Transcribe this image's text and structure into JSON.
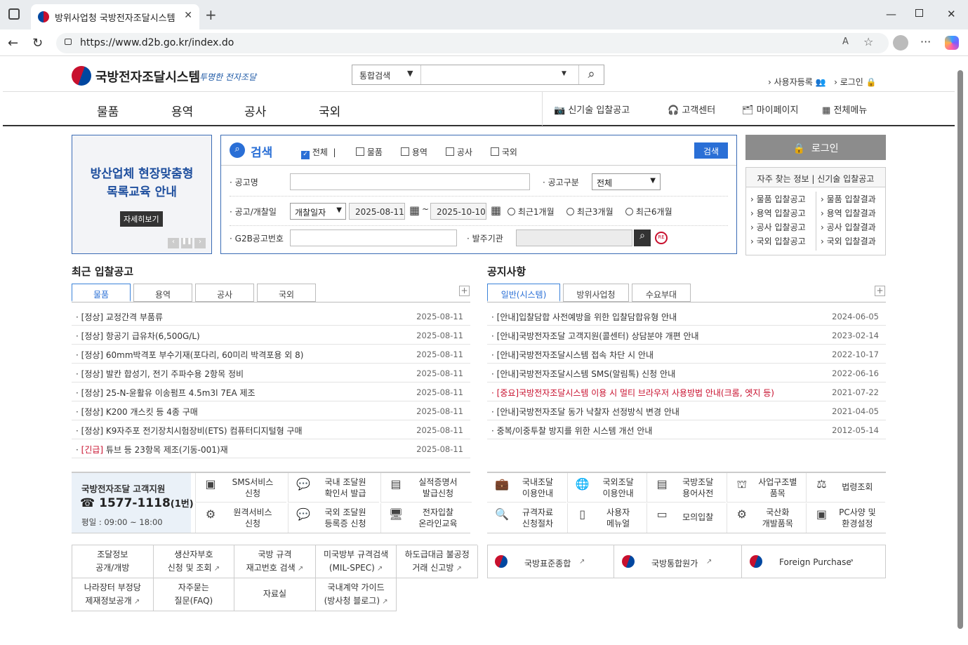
{
  "browser": {
    "tab_title": "방위사업청 국방전자조달시스템",
    "url": "https://www.d2b.go.kr/index.do"
  },
  "header": {
    "logo_text": "국방전자조달시스템",
    "slogan": "투명한 전자조달",
    "search_scope": "통합검색",
    "links": [
      "사용자등록",
      "로그인"
    ]
  },
  "nav": {
    "items": [
      "물품",
      "용역",
      "공사",
      "국외"
    ],
    "right": [
      "신기술 입찰공고",
      "고객센터",
      "마이페이지",
      "전체메뉴"
    ]
  },
  "banner": {
    "line1": "방산업체 현장맞춤형",
    "line2": "목록교육 안내",
    "button": "자세히보기"
  },
  "search": {
    "title": "검색",
    "checks": [
      "전체",
      "물품",
      "용역",
      "공사",
      "국외"
    ],
    "button": "검색",
    "label_name": "공고명",
    "label_type": "공고구분",
    "type_value": "전체",
    "label_date": "공고/개찰일",
    "date_type": "개찰일자",
    "date_from": "2025-08-11",
    "date_to": "2025-10-10",
    "date_sep": "~",
    "radios": [
      "최근1개월",
      "최근3개월",
      "최근6개월"
    ],
    "label_g2b": "G2B공고번호",
    "label_org": "발주기관"
  },
  "login": {
    "button": "로그인",
    "faq_title": "자주 찾는 정보 | 신기술 입찰공고",
    "links_left": [
      "물품 입찰공고",
      "용역 입찰공고",
      "공사 입찰공고",
      "국외 입찰공고"
    ],
    "links_right": [
      "물품 입찰결과",
      "용역 입찰결과",
      "공사 입찰결과",
      "국외 입찰결과"
    ]
  },
  "bids": {
    "title": "최근 입찰공고",
    "tabs": [
      "물품",
      "용역",
      "공사",
      "국외"
    ],
    "rows": [
      {
        "text": "[정상] 교정간격 부품류",
        "date": "2025-08-11"
      },
      {
        "text": "[정상] 항공기 급유차(6,500G/L)",
        "date": "2025-08-11"
      },
      {
        "text": "[정상] 60mm박격포 부수기재(포다리, 60미리 박격포용 외 8)",
        "date": "2025-08-11"
      },
      {
        "text": "[정상] 발칸 합성기, 전기 주파수용 2항목 정비",
        "date": "2025-08-11"
      },
      {
        "text": "[정상] 25-N-윤활유 이송펌프 4.5m3l 7EA 제조",
        "date": "2025-08-11"
      },
      {
        "text": "[정상] K200 개스킷 등 4종 구매",
        "date": "2025-08-11"
      },
      {
        "text": "[정상] K9자주포 전기장치시험장비(ETS) 컴퓨터디지털형 구매",
        "date": "2025-08-11"
      },
      {
        "text": "[긴급] 튜브 등 23항목 제조(기동-001)재",
        "date": "2025-08-11",
        "urgent_tag": "[긴급]",
        "rest": " 튜브 등 23항목 제조(기동-001)재"
      }
    ]
  },
  "notices": {
    "title": "공지사항",
    "tabs": [
      "일반(시스템)",
      "방위사업청",
      "수요부대"
    ],
    "rows": [
      {
        "text": "[안내]입찰담합 사전예방을 위한 입찰담합유형 안내",
        "date": "2024-06-05"
      },
      {
        "text": "[안내]국방전자조달 고객지원(콜센터) 상담분야 개편 안내",
        "date": "2023-02-14"
      },
      {
        "text": "[안내]국방전자조달시스템 접속 차단 시 안내",
        "date": "2022-10-17"
      },
      {
        "text": "[안내]국방전자조달시스템 SMS(알림톡) 신청 안내",
        "date": "2022-06-16"
      },
      {
        "text": "[중요]국방전자조달시스템 이용 시 멀티 브라우저 사용방법 안내(크롬, 엣지 등)",
        "date": "2021-07-22",
        "important": true
      },
      {
        "text": "[안내]국방전자조달 동가 낙찰자 선정방식 변경 안내",
        "date": "2021-04-05"
      },
      {
        "text": "중복/이중투찰 방지를 위한 시스템 개선 안내",
        "date": "2012-05-14"
      }
    ]
  },
  "support": {
    "title": "국방전자조달 고객지원",
    "phone": "1577-1118",
    "phone_ext": "(1번)",
    "hours": "평일 : 09:00 ~ 18:00",
    "services": [
      [
        "SMS서비스",
        "신청"
      ],
      [
        "국내 조달원",
        "확인서 발급"
      ],
      [
        "실적증명서",
        "발급신청"
      ],
      [
        "원격서비스",
        "신청"
      ],
      [
        "국외 조달원",
        "등록증 신청"
      ],
      [
        "전자입찰",
        "온라인교육"
      ]
    ]
  },
  "right_services": [
    [
      "국내조달",
      "이용안내"
    ],
    [
      "국외조달",
      "이용안내"
    ],
    [
      "국방조달",
      "용어사전"
    ],
    [
      "사업구조별",
      "품목"
    ],
    [
      "법령조회",
      ""
    ],
    [
      "규격자료",
      "신청절차"
    ],
    [
      "사용자",
      "메뉴얼"
    ],
    [
      "모의입찰",
      ""
    ],
    [
      "국산화",
      "개발품목"
    ],
    [
      "PC사양 및",
      "환경설정"
    ]
  ],
  "links_table": [
    [
      "조달정보",
      "공개/개방"
    ],
    [
      "생산자부호",
      "신청 및 조회"
    ],
    [
      "국방 규격",
      "재고번호 검색"
    ],
    [
      "미국방부 규격검색",
      "(MIL-SPEC)"
    ],
    [
      "하도급대금 불공정",
      "거래 신고방"
    ],
    [
      "나라장터 부정당",
      "제재정보공개"
    ],
    [
      "자주묻는",
      "질문(FAQ)"
    ],
    [
      "자료실",
      ""
    ],
    [
      "국내계약 가이드",
      "(방사청 블로그)"
    ]
  ],
  "related_sites": [
    "국방표준종합",
    "국방통합원가",
    "Foreign Purchase"
  ],
  "colors": {
    "accent": "#2a6fd6",
    "urgent": "#c8102e",
    "login_bg": "#8c8c8c"
  }
}
